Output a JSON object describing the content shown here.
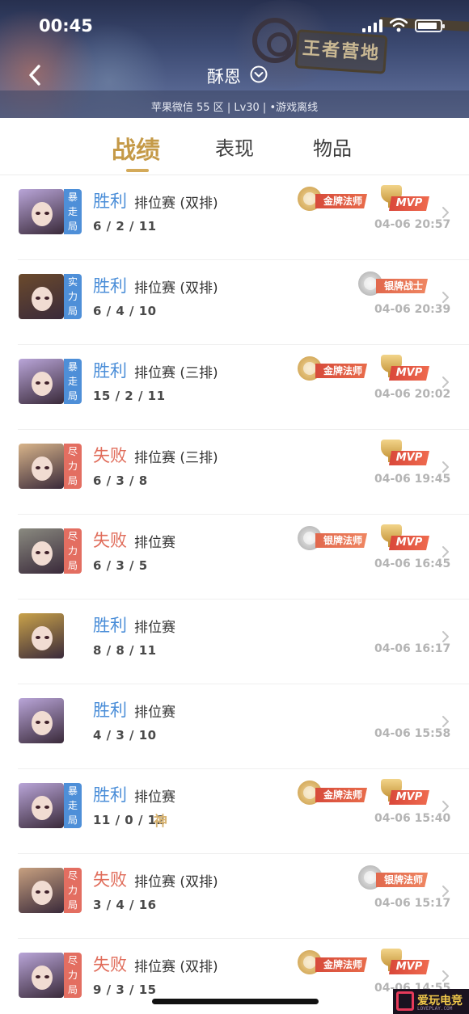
{
  "status_bar": {
    "time": "00:45",
    "battery_level": 0.9
  },
  "header": {
    "banner_sign": "王者营地",
    "player_name": "酥恩",
    "sub_info": "苹果微信 55 区 | Lv30 | •游戏离线"
  },
  "tabs": [
    {
      "label": "战绩",
      "active": true
    },
    {
      "label": "表现",
      "active": false
    },
    {
      "label": "物品",
      "active": false
    }
  ],
  "matches": [
    {
      "tag": "暴走局",
      "tag_color": "#4e8fd8",
      "avatar_color": "#b9a5d8",
      "result": "胜利",
      "win": true,
      "mode": "排位赛 (双排)",
      "kda": "6 / 2 / 11",
      "badge": "金牌法师",
      "badge_type": "gold",
      "mvp": true,
      "god": "",
      "time": "04-06 20:57"
    },
    {
      "tag": "实力局",
      "tag_color": "#4e8fd8",
      "avatar_color": "#6b4a2c",
      "result": "胜利",
      "win": true,
      "mode": "排位赛 (双排)",
      "kda": "6 / 4 / 10",
      "badge": "银牌战士",
      "badge_type": "silver",
      "mvp": false,
      "god": "",
      "time": "04-06 20:39"
    },
    {
      "tag": "暴走局",
      "tag_color": "#4e8fd8",
      "avatar_color": "#b9a5d8",
      "result": "胜利",
      "win": true,
      "mode": "排位赛 (三排)",
      "kda": "15 / 2 / 11",
      "badge": "金牌法师",
      "badge_type": "gold",
      "mvp": true,
      "god": "",
      "time": "04-06 20:02"
    },
    {
      "tag": "尽力局",
      "tag_color": "#e36e61",
      "avatar_color": "#d8b48a",
      "result": "失败",
      "win": false,
      "mode": "排位赛 (三排)",
      "kda": "6 / 3 / 8",
      "badge": "",
      "badge_type": "",
      "mvp": true,
      "god": "",
      "time": "04-06 19:45"
    },
    {
      "tag": "尽力局",
      "tag_color": "#e36e61",
      "avatar_color": "#8a8a80",
      "result": "失败",
      "win": false,
      "mode": "排位赛",
      "kda": "6 / 3 / 5",
      "badge": "银牌法师",
      "badge_type": "silver",
      "mvp": true,
      "god": "",
      "time": "04-06 16:45"
    },
    {
      "tag": "",
      "tag_color": "",
      "avatar_color": "#c9a24a",
      "result": "胜利",
      "win": true,
      "mode": "排位赛",
      "kda": "8 / 8 / 11",
      "badge": "",
      "badge_type": "",
      "mvp": false,
      "god": "",
      "time": "04-06 16:17"
    },
    {
      "tag": "",
      "tag_color": "",
      "avatar_color": "#b9a5d8",
      "result": "胜利",
      "win": true,
      "mode": "排位赛",
      "kda": "4 / 3 / 10",
      "badge": "",
      "badge_type": "",
      "mvp": false,
      "god": "",
      "time": "04-06 15:58"
    },
    {
      "tag": "暴走局",
      "tag_color": "#4e8fd8",
      "avatar_color": "#b9a5d8",
      "result": "胜利",
      "win": true,
      "mode": "排位赛",
      "kda": "11 / 0 / 12",
      "badge": "金牌法师",
      "badge_type": "gold",
      "mvp": true,
      "god": "神",
      "time": "04-06 15:40"
    },
    {
      "tag": "尽力局",
      "tag_color": "#e36e61",
      "avatar_color": "#c7a080",
      "result": "失败",
      "win": false,
      "mode": "排位赛 (双排)",
      "kda": "3 / 4 / 16",
      "badge": "银牌法师",
      "badge_type": "silver",
      "mvp": false,
      "god": "",
      "time": "04-06 15:17"
    },
    {
      "tag": "尽力局",
      "tag_color": "#e36e61",
      "avatar_color": "#b9a5d8",
      "result": "失败",
      "win": false,
      "mode": "排位赛 (双排)",
      "kda": "9 / 3 / 15",
      "badge": "金牌法师",
      "badge_type": "gold",
      "mvp": true,
      "god": "",
      "time": "04-06 14:55"
    }
  ],
  "mvp_label": "MVP",
  "watermark": {
    "text": "爱玩电竞",
    "sub": "LOVEPLAY.COM"
  },
  "icons": {
    "back": "back-arrow-icon",
    "dropdown": "chevron-down-circle-icon",
    "row_arrow": "chevron-right-icon"
  }
}
